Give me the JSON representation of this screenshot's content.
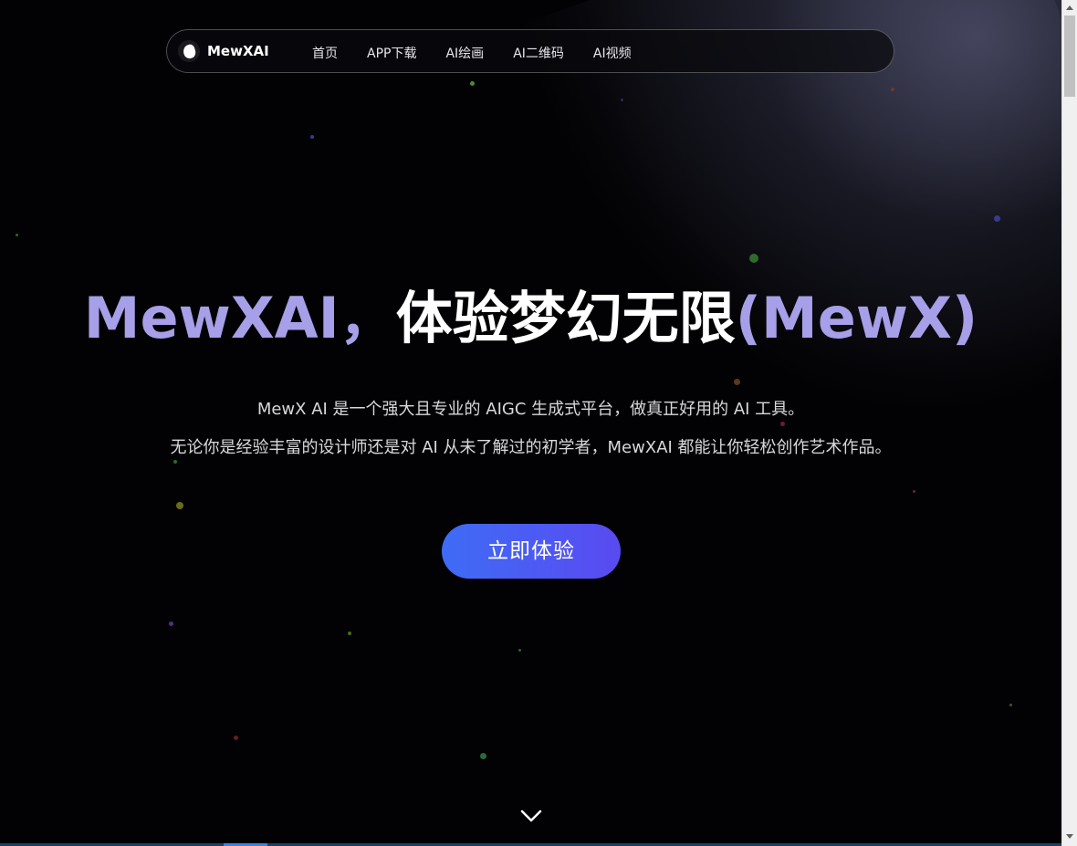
{
  "nav": {
    "brand": "MewXAI",
    "links": [
      "首页",
      "APP下载",
      "AI绘画",
      "AI二维码",
      "AI视频"
    ]
  },
  "hero": {
    "title_part1": "MewXAI，",
    "title_part2": "体验梦幻无限",
    "title_part3": "(MewX)",
    "subtitle_line1": "MewX AI 是一个强大且专业的 AIGC 生成式平台，做真正好用的 AI 工具。",
    "subtitle_line2": "无论你是经验丰富的设计师还是对 AI 从未了解过的初学者，MewXAI 都能让你轻松创作艺术作品。",
    "cta": "立即体验"
  },
  "icons": {
    "logo": "cat-logo-icon",
    "scroll": "chevron-down-icon"
  },
  "colors": {
    "background": "#020204",
    "title_accent": "#a79fe8",
    "cta_gradient_start": "#3e6cf6",
    "cta_gradient_end": "#5a4af0"
  }
}
